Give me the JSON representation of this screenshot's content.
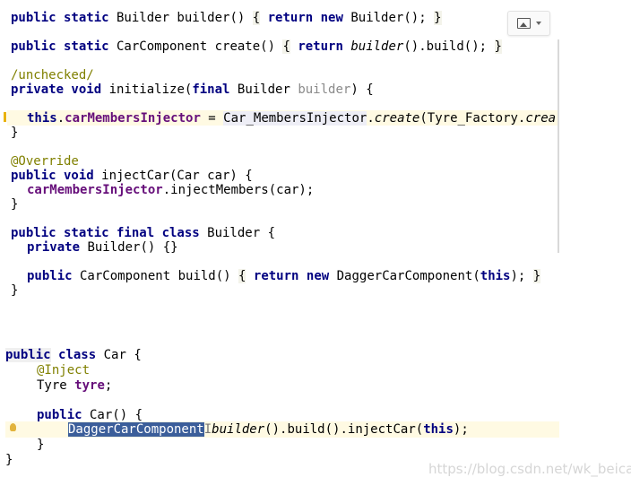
{
  "code_top": {
    "l1": {
      "a": "public static",
      "b": " Builder builder() ",
      "c": "{",
      "d": " ",
      "e": "return new",
      "f": " Builder(); ",
      "g": "}"
    },
    "l2": {
      "a": "public static",
      "b": " CarComponent create() ",
      "c": "{",
      "d": " ",
      "e": "return",
      "f": " ",
      "g": "builder",
      "h": "().build(); ",
      "i": "}"
    },
    "l3": {
      "a": "/unchecked/"
    },
    "l4": {
      "a": "private void",
      "b": " initialize(",
      "c": "final",
      "d": " Builder ",
      "e": "builder",
      "f": ") {"
    },
    "l5": {
      "a": "this",
      "b": ".",
      "c": "carMembersInjector",
      "d": " = ",
      "e": "Car_M",
      "f": "embersInjector",
      "g": ".",
      "h": "create",
      "i": "(Tyre_Factory.",
      "j": "crea"
    },
    "l6": {
      "a": "}"
    },
    "l7": {
      "a": "@Override"
    },
    "l8": {
      "a": "public void",
      "b": " injectCar(Car car) {"
    },
    "l9": {
      "a": "carMembersInjector",
      "b": ".injectMembers(car);"
    },
    "l10": {
      "a": "}"
    },
    "l11": {
      "a": "public static final class",
      "b": " Builder {"
    },
    "l12": {
      "a": "private",
      "b": " Builder() {}"
    },
    "l13": {
      "a": "public",
      "b": " CarComponent build() ",
      "c": "{",
      "d": " ",
      "e": "return new",
      "f": " DaggerCarComponent(",
      "g": "this",
      "h": "); ",
      "i": "}"
    },
    "l14": {
      "a": "}"
    }
  },
  "code_bottom": {
    "l1": {
      "a": "public",
      "b": " ",
      "c": "class",
      "d": " Car {"
    },
    "l2": {
      "a": "@Inject"
    },
    "l3": {
      "a": "Tyre ",
      "b": "tyre",
      "c": ";"
    },
    "l4": {
      "a": "public",
      "b": " Car() {"
    },
    "l5": {
      "a": "DaggerCarComponent",
      "b": "I",
      "c": "builder",
      "d": "().build().injectCar(",
      "e": "this",
      "f": ");"
    },
    "l6": {
      "a": "}"
    },
    "l7": {
      "a": "}"
    }
  },
  "watermark": "https://blog.csdn.net/wk_beicai",
  "toolbar": {
    "image_icon": "image-icon",
    "dropdown_icon": "chevron-down-icon"
  },
  "colors": {
    "keyword": "#000080",
    "annotation": "#808000",
    "field": "#660e7a",
    "selection": "#3b5e9a",
    "current_line": "#fffae3"
  }
}
